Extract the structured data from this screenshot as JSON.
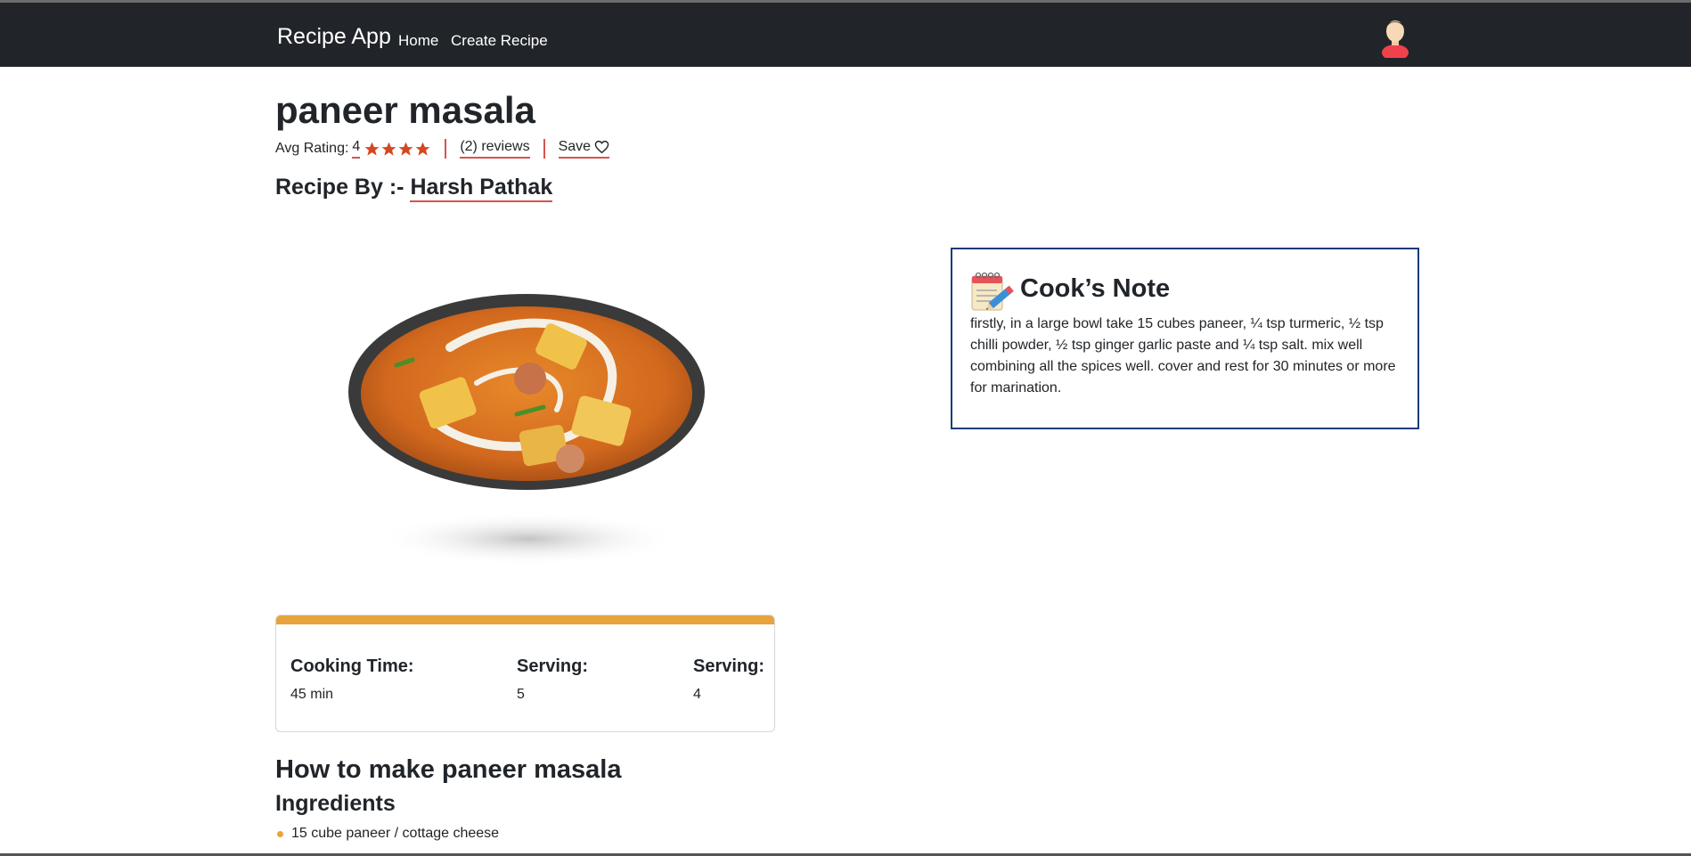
{
  "app": {
    "brand": "Recipe App"
  },
  "nav": {
    "home": "Home",
    "create": "Create Recipe"
  },
  "recipe": {
    "title": "paneer masala",
    "avg_rating_label": "Avg Rating:",
    "avg_rating": "4",
    "rating_stars": 4,
    "reviews_label": "(2) reviews",
    "save_label": "Save",
    "recipe_by_label": "Recipe By :-",
    "author": "Harsh Pathak"
  },
  "info": {
    "cooking_time_label": "Cooking Time:",
    "cooking_time": "45 min",
    "serving_label_1": "Serving:",
    "serving_1": "5",
    "serving_label_2": "Serving:",
    "serving_2": "4"
  },
  "howto": {
    "title": "How to make paneer masala",
    "ingredients_label": "Ingredients",
    "ingredients": [
      "15 cube paneer / cottage cheese"
    ]
  },
  "note": {
    "title": "Cook’s Note",
    "text": "firstly, in a large bowl take 15 cubes paneer, ¼ tsp turmeric, ½ tsp chilli powder, ½ tsp ginger garlic paste and ¼ tsp salt. mix well combining all the spices well. cover and rest for 30 minutes or more for marination."
  },
  "colors": {
    "navbar": "#212529",
    "accent_red": "#d9534f",
    "star": "#d4471f",
    "info_bar": "#e8a33d",
    "note_border": "#1a3b7a"
  }
}
